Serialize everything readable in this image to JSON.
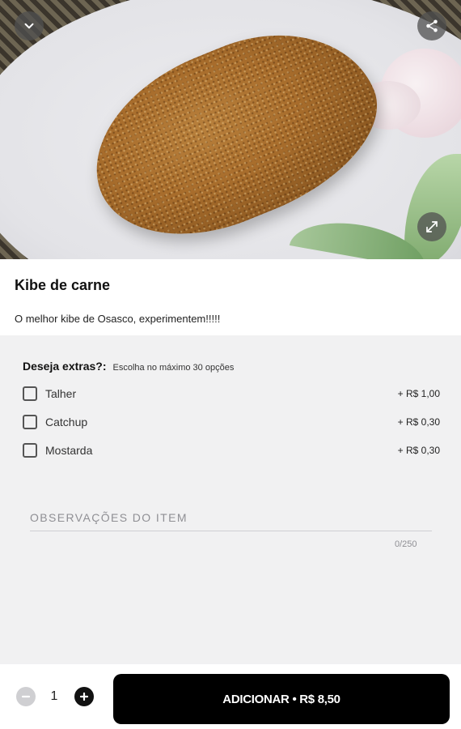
{
  "item": {
    "title": "Kibe de carne",
    "description": "O melhor kibe de Osasco, experimentem!!!!!"
  },
  "extras": {
    "title": "Deseja extras?:",
    "hint": "Escolha no máximo 30 opções",
    "options": [
      {
        "label": "Talher",
        "price": "+ R$ 1,00",
        "checked": false
      },
      {
        "label": "Catchup",
        "price": "+ R$ 0,30",
        "checked": false
      },
      {
        "label": "Mostarda",
        "price": "+ R$ 0,30",
        "checked": false
      }
    ]
  },
  "notes": {
    "placeholder": "OBSERVAÇÕES DO ITEM",
    "counter": "0/250"
  },
  "bottom_bar": {
    "quantity": "1",
    "add_label": "ADICIONAR • R$ 8,50"
  },
  "icons": {
    "collapse": "chevron-down-icon",
    "share": "share-icon",
    "expand": "expand-icon",
    "minus": "minus-icon",
    "plus": "plus-icon"
  },
  "colors": {
    "button_bg": "#000000",
    "options_bg": "#f1f1f2"
  }
}
